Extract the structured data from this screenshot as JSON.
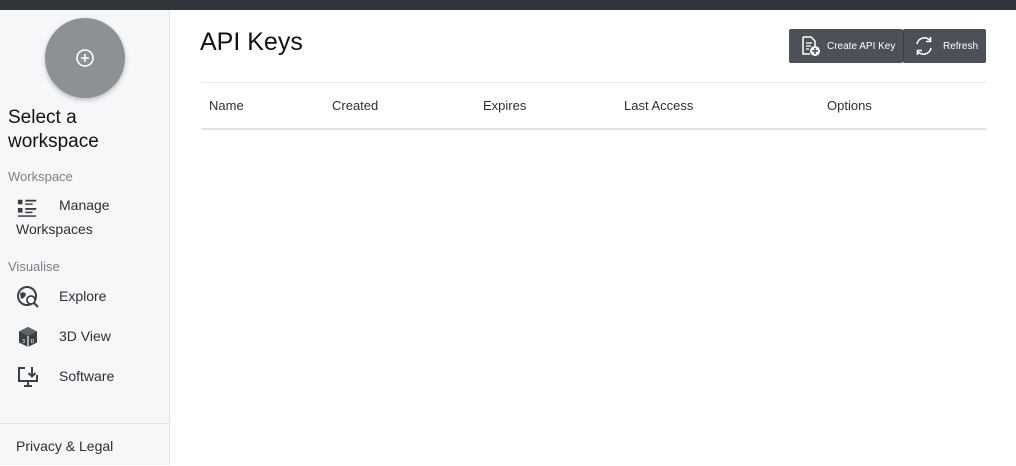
{
  "sidebar": {
    "workspace_title": "Select a workspace",
    "sections": {
      "workspace": "Workspace",
      "visualise": "Visualise"
    },
    "items": {
      "manage_line1": "Manage",
      "manage_line2": "Workspaces",
      "explore": "Explore",
      "view3d": "3D View",
      "software": "Software"
    },
    "footer": "Privacy & Legal"
  },
  "main": {
    "title": "API Keys",
    "buttons": {
      "create": "Create API Key",
      "refresh": "Refresh"
    },
    "table": {
      "columns": [
        "Name",
        "Created",
        "Expires",
        "Last Access",
        "Options"
      ],
      "rows": []
    }
  },
  "icons": {
    "add_workspace": "plus-circle-icon",
    "manage": "list-icon",
    "explore": "globe-search-icon",
    "view3d": "cube-icon",
    "software": "download-monitor-icon",
    "create": "document-plus-icon",
    "refresh": "refresh-icon"
  },
  "colors": {
    "topbar": "#2f353b",
    "sidebar_bg": "#f6f7f8",
    "button_bg": "#4b5157",
    "workspace_circle": "#8c9196"
  }
}
